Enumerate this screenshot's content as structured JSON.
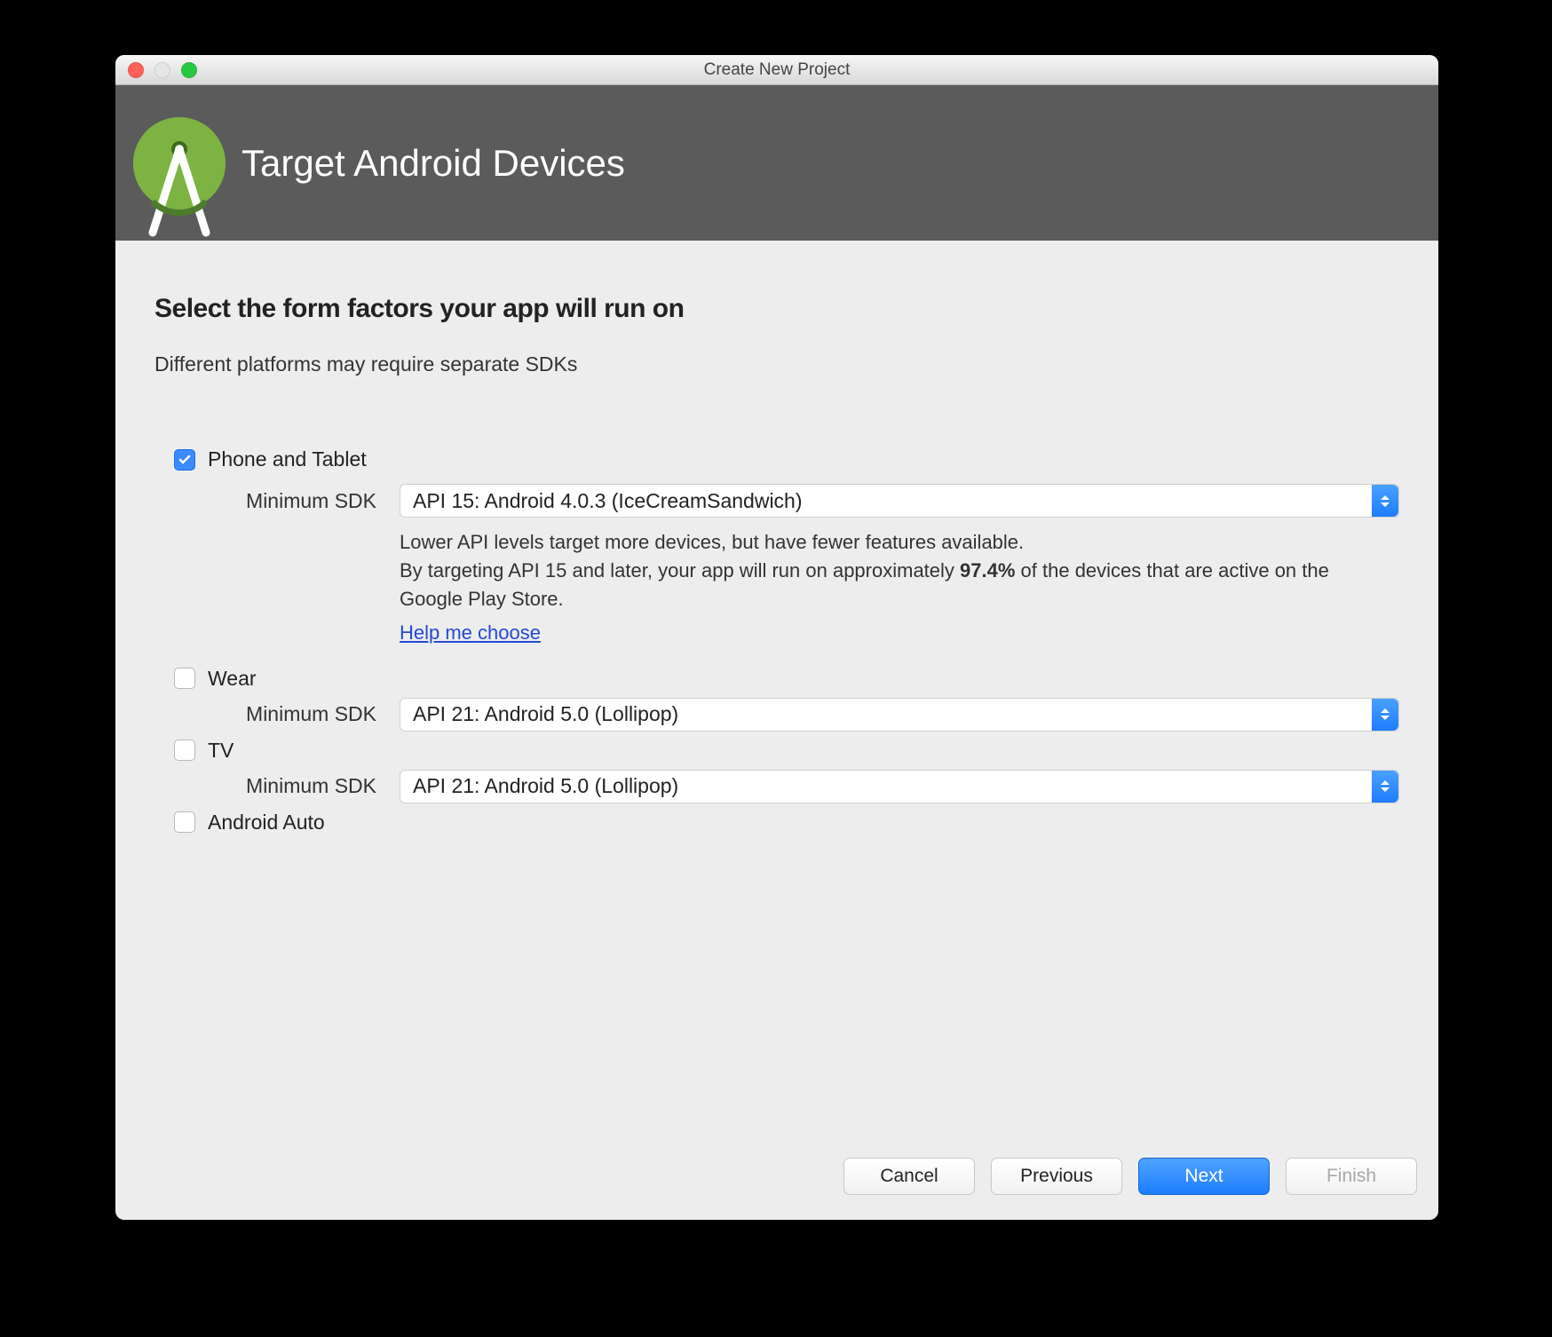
{
  "window": {
    "title": "Create New Project"
  },
  "header": {
    "title": "Target Android Devices"
  },
  "section": {
    "title": "Select the form factors your app will run on",
    "subtitle": "Different platforms may require separate SDKs"
  },
  "labels": {
    "min_sdk": "Minimum SDK"
  },
  "form_factors": {
    "phone_tablet": {
      "label": "Phone and Tablet",
      "checked": true,
      "sdk": "API 15: Android 4.0.3 (IceCreamSandwich)",
      "hint_line1": "Lower API levels target more devices, but have fewer features available.",
      "hint_line2a": "By targeting API 15 and later, your app will run on approximately ",
      "hint_pct": "97.4%",
      "hint_line2b": " of the devices that are active on the Google Play Store.",
      "help_link": "Help me choose"
    },
    "wear": {
      "label": "Wear",
      "checked": false,
      "sdk": "API 21: Android 5.0 (Lollipop)"
    },
    "tv": {
      "label": "TV",
      "checked": false,
      "sdk": "API 21: Android 5.0 (Lollipop)"
    },
    "auto": {
      "label": "Android Auto",
      "checked": false
    }
  },
  "buttons": {
    "cancel": "Cancel",
    "previous": "Previous",
    "next": "Next",
    "finish": "Finish"
  }
}
